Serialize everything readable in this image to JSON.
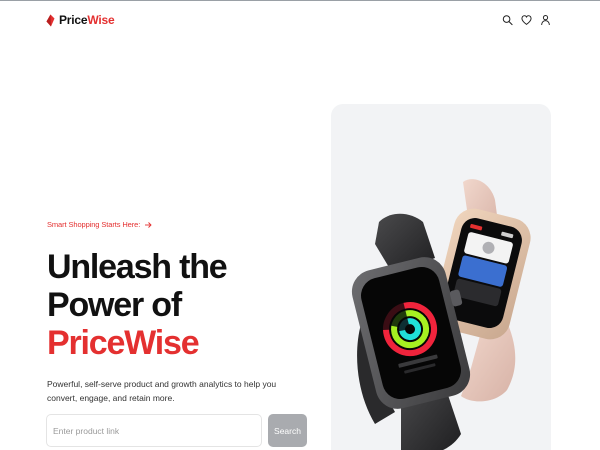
{
  "brand": {
    "name_part1": "Price",
    "name_part2": "Wise",
    "accent_color": "#e43030"
  },
  "nav": {
    "icons": [
      "search-icon",
      "heart-icon",
      "user-icon"
    ]
  },
  "hero": {
    "tagline": "Smart Shopping Starts Here:",
    "tagline_icon": "arrow-right-icon",
    "headline_line1": "Unleash the Power of",
    "headline_brand": "PriceWise",
    "description": "Powerful, self-serve product and growth analytics to help you convert, engage, and retain more.",
    "image_subject": "apple-watch-product-image"
  },
  "search": {
    "placeholder": "Enter product link",
    "value": "",
    "button_label": "Search",
    "button_color": "#a9abaf"
  }
}
